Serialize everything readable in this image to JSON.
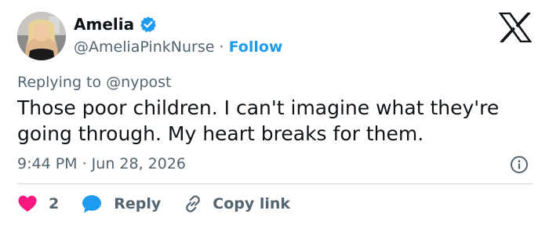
{
  "author": {
    "name": "Amelia",
    "handle": "@AmeliaPinkNurse",
    "separator": "·",
    "follow_label": "Follow",
    "verified_icon": "verified-badge-icon",
    "verified_color": "#1d9bf0"
  },
  "logo": {
    "icon": "x-logo-icon"
  },
  "tweet": {
    "replying_to": "Replying to @nypost",
    "text": "Those poor children. I can't imagine what they're going through. My heart breaks for them.",
    "timestamp": "9:44 PM · Jun 28, 2026"
  },
  "actions": {
    "like_count": "2",
    "like_color": "#f91880",
    "reply_label": "Reply",
    "reply_color": "#1d9bf0",
    "copy_link_label": "Copy link"
  },
  "colors": {
    "text_primary": "#0f1419",
    "text_secondary": "#536471",
    "accent": "#1d9bf0",
    "divider": "#cfd9de"
  }
}
